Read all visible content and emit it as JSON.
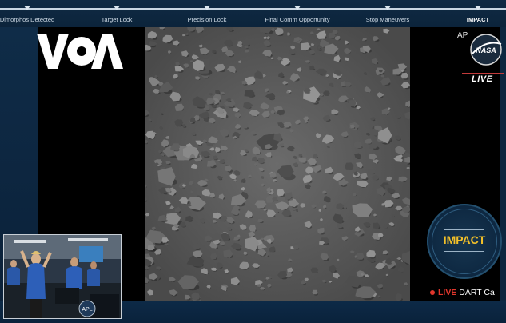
{
  "timeline": {
    "progress": 1.0,
    "milestones": [
      {
        "label": "Dimorphos Detected"
      },
      {
        "label": "Target Lock"
      },
      {
        "label": "Precision Lock"
      },
      {
        "label": "Final Comm Opportunity"
      },
      {
        "label": "Stop Maneuvers"
      },
      {
        "label": "IMPACT"
      }
    ]
  },
  "branding": {
    "voa_logo": "VOA",
    "ap_label": "AP",
    "nasa_logo": "NASA",
    "live_label": "LIVE"
  },
  "badge": {
    "text": "IMPACT",
    "color": "#f2c029"
  },
  "ticker": {
    "live": "LIVE",
    "text": "DART Ca"
  },
  "inset": {
    "camera_label": "APL"
  },
  "colors": {
    "accent": "#f2c029",
    "live_red": "#e0362c",
    "panel_blue": "#0d2740"
  }
}
